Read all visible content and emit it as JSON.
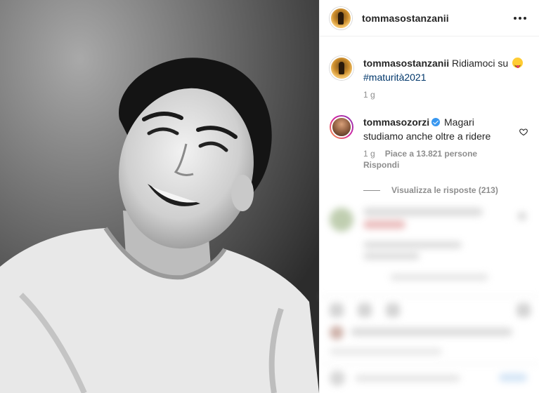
{
  "post": {
    "username": "tommasostanzanii",
    "caption": {
      "username": "tommasostanzanii",
      "text": "Ridiamoci su",
      "emoji": "😛",
      "hashtag": "#maturità2021",
      "time": "1 g"
    }
  },
  "comment": {
    "username": "tommasozorzi",
    "text": "Magari studiamo anche oltre a ridere",
    "time": "1 g",
    "likes": "Piace a 13.821 persone",
    "reply": "Rispondi",
    "view_replies": "Visualizza le risposte (213)"
  },
  "icons": {
    "more": "more-horizontal-icon",
    "like": "heart-outline-icon",
    "verified": "verified-badge-icon"
  },
  "colors": {
    "hashtag": "#00376b",
    "verified": "#3897f0",
    "muted": "#8e8e8e"
  }
}
